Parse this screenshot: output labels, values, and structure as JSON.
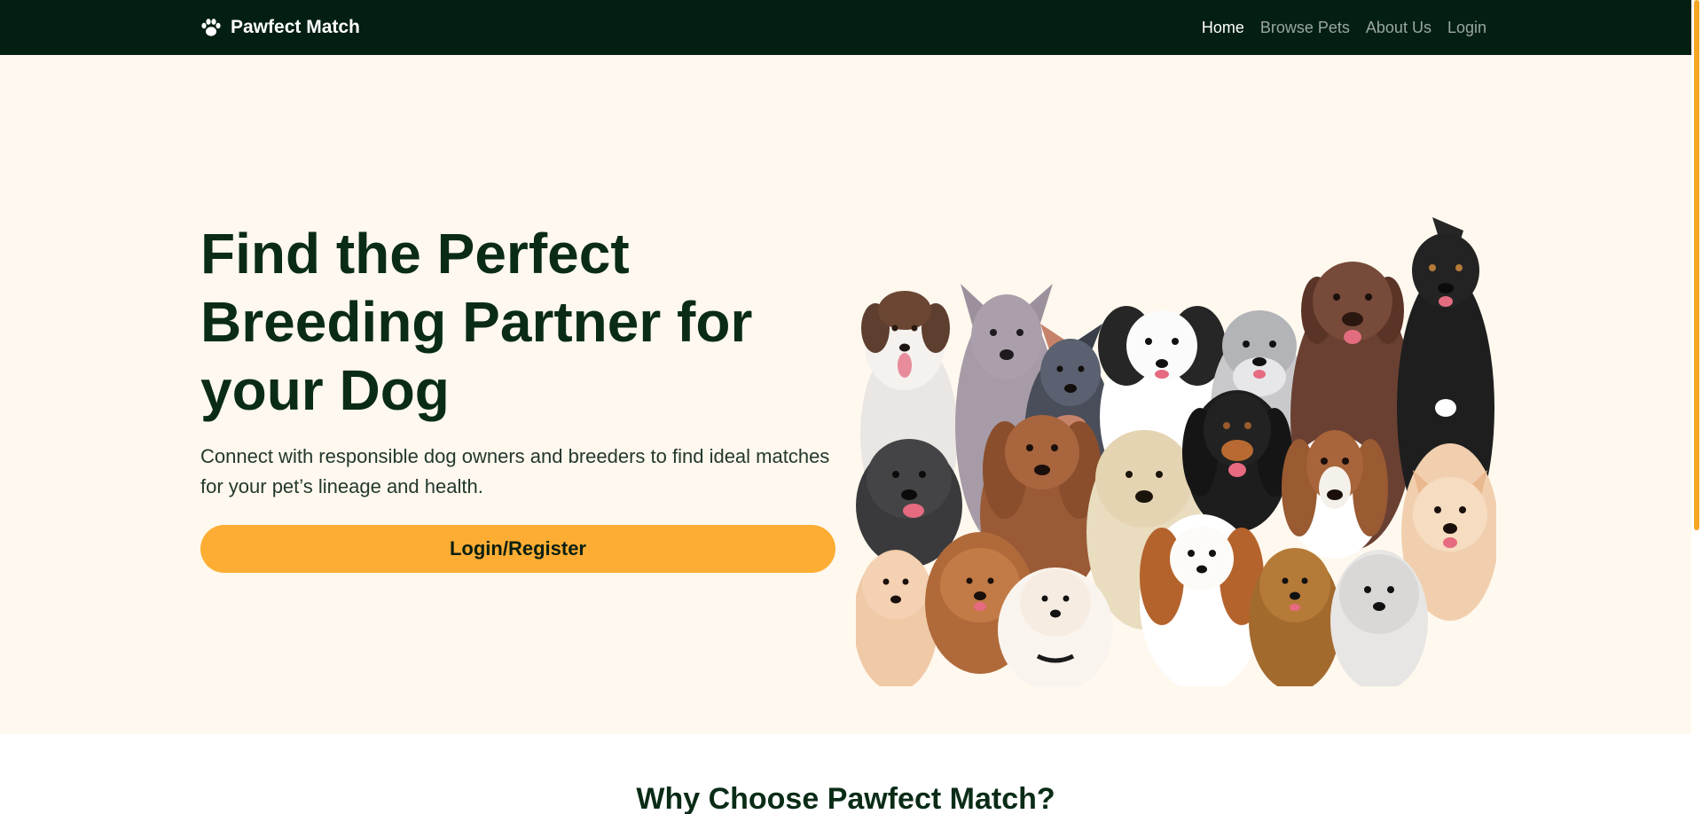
{
  "nav": {
    "brand": "Pawfect Match",
    "brand_icon": "paw-icon",
    "links": [
      {
        "label": "Home",
        "active": true
      },
      {
        "label": "Browse Pets",
        "active": false
      },
      {
        "label": "About Us",
        "active": false
      },
      {
        "label": "Login",
        "active": false
      }
    ]
  },
  "hero": {
    "title": "Find the Perfect Breeding Partner for your Dog",
    "subtitle": "Connect with responsible dog owners and breeders to find ideal matches for your pet’s lineage and health.",
    "button_label": "Login/Register"
  },
  "features": {
    "heading": "Why Choose Pawfect Match?"
  },
  "colors": {
    "nav_bg": "#031f12",
    "hero_bg": "#fff8ee",
    "accent": "#fdad33",
    "heading": "#0a2c17"
  }
}
